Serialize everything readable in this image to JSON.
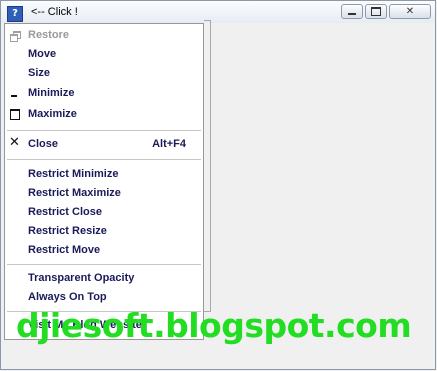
{
  "window": {
    "title": "<-- Click !",
    "icon": "question-icon",
    "app_icon_glyph": "?"
  },
  "caption_buttons": [
    "minimize-icon",
    "maximize-icon",
    "close-icon"
  ],
  "system_menu": {
    "items": [
      {
        "label": "Restore",
        "enabled": false,
        "icon": "restore-icon"
      },
      {
        "label": "Move",
        "enabled": true
      },
      {
        "label": "Size",
        "enabled": true
      },
      {
        "label": "Minimize",
        "enabled": true,
        "icon": "minimize-icon"
      },
      {
        "label": "Maximize",
        "enabled": true,
        "icon": "maximize-icon"
      },
      {
        "label": "Close",
        "enabled": true,
        "icon": "close-icon",
        "accelerator": "Alt+F4"
      },
      {
        "label": "Restrict Minimize",
        "enabled": true
      },
      {
        "label": "Restrict Maximize",
        "enabled": true
      },
      {
        "label": "Restrict Close",
        "enabled": true
      },
      {
        "label": "Restrict Resize",
        "enabled": true
      },
      {
        "label": "Restrict Move",
        "enabled": true
      },
      {
        "label": "Transparent Opacity",
        "enabled": true
      },
      {
        "label": "Always On Top",
        "enabled": true
      },
      {
        "label": "Visit My Blog Website",
        "enabled": true
      }
    ]
  },
  "watermark": "djiesoft.blogspot.com",
  "colors": {
    "menu_text": "#1b1b5a",
    "disabled_text": "#9a9a9a",
    "watermark": "#22dd22"
  }
}
